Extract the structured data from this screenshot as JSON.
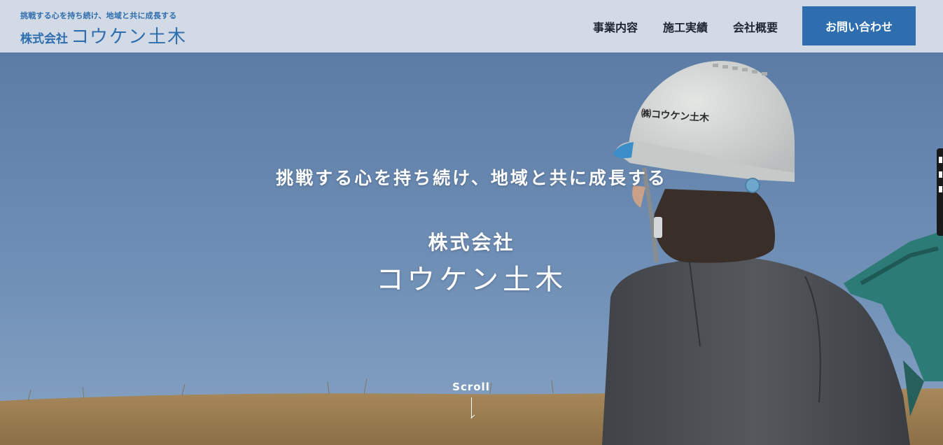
{
  "header": {
    "logo_tagline": "挑戦する心を持ち続け、地域と共に成長する",
    "logo_prefix": "株式会社",
    "logo_name": "コウケン土木",
    "nav": [
      {
        "label": "事業内容"
      },
      {
        "label": "施工実績"
      },
      {
        "label": "会社概要"
      }
    ],
    "contact_label": "お問い合わせ"
  },
  "hero": {
    "tagline": "挑戦する心を持ち続け、地域と共に成長する",
    "company_prefix": "株式会社",
    "company_name": "コウケン土木",
    "helmet_text": "㈱コウケン土木",
    "scroll_label": "Scroll"
  },
  "colors": {
    "brand": "#2f6eae",
    "header_bg": "#d2dae6",
    "sky": "#6a88ad",
    "grass": "#a8895a"
  }
}
